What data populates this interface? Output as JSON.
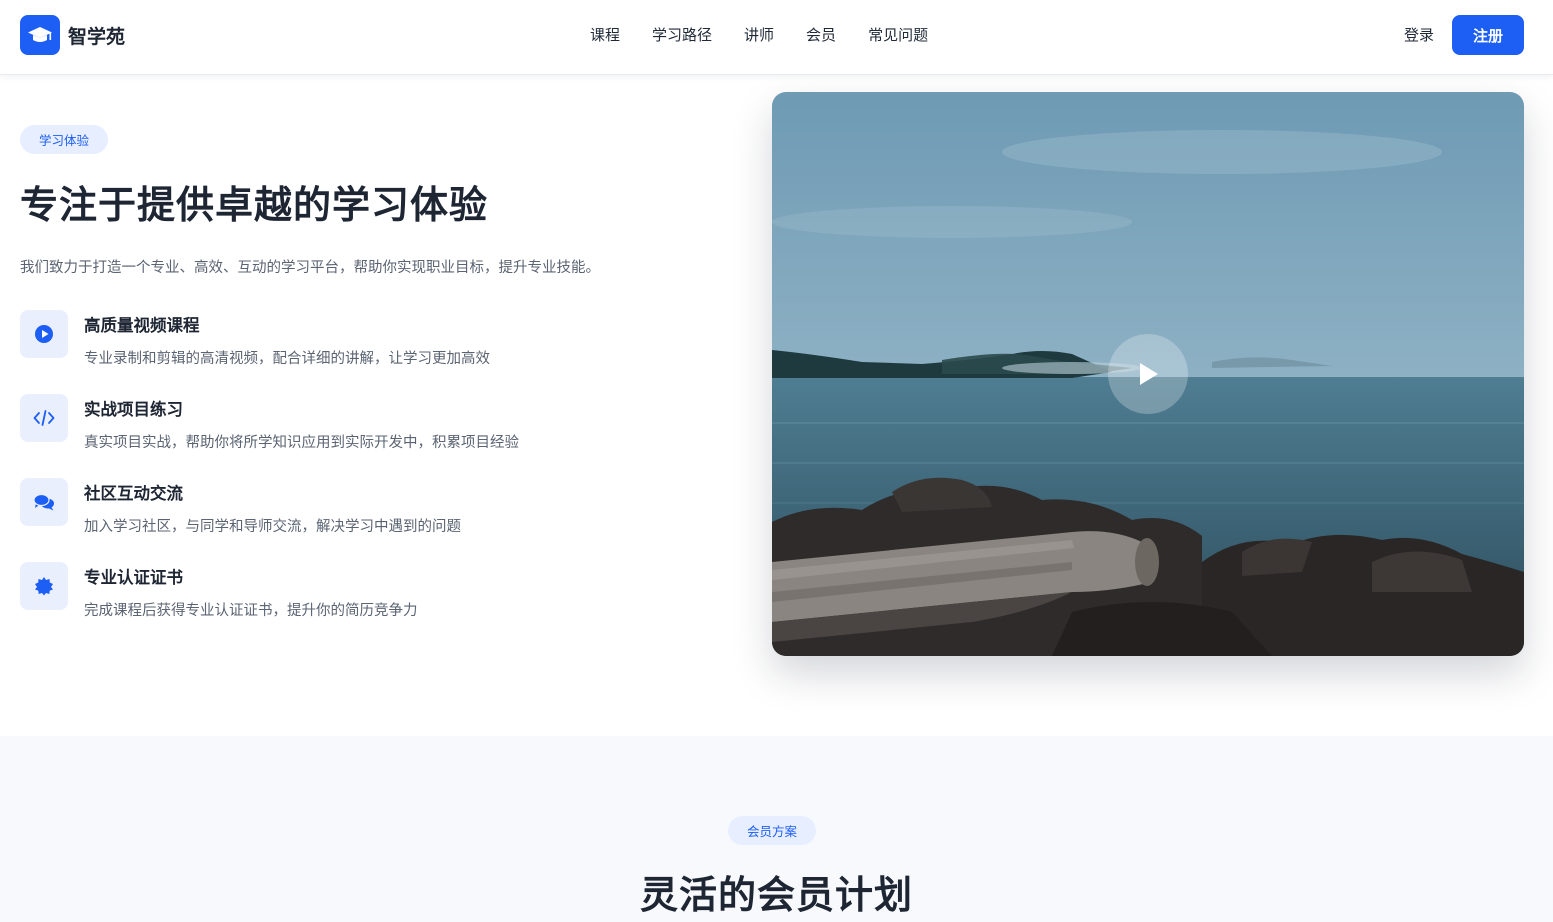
{
  "header": {
    "brand": "智学苑",
    "nav": [
      "课程",
      "学习路径",
      "讲师",
      "会员",
      "常见问题"
    ],
    "login": "登录",
    "register": "注册"
  },
  "hero": {
    "badge": "学习体验",
    "title": "专注于提供卓越的学习体验",
    "description": "我们致力于打造一个专业、高效、互动的学习平台，帮助你实现职业目标，提升专业技能。",
    "features": [
      {
        "icon": "play-circle-icon",
        "title": "高质量视频课程",
        "desc": "专业录制和剪辑的高清视频，配合详细的讲解，让学习更加高效"
      },
      {
        "icon": "code-icon",
        "title": "实战项目练习",
        "desc": "真实项目实战，帮助你将所学知识应用到实际开发中，积累项目经验"
      },
      {
        "icon": "chat-bubbles-icon",
        "title": "社区互动交流",
        "desc": "加入学习社区，与同学和导师交流，解决学习中遇到的问题"
      },
      {
        "icon": "certificate-badge-icon",
        "title": "专业认证证书",
        "desc": "完成课程后获得专业认证证书，提升你的简历竞争力"
      }
    ]
  },
  "membership": {
    "badge": "会员方案",
    "title": "灵活的会员计划"
  },
  "colors": {
    "accent": "#1d5ef5",
    "badge_bg": "#e6eeff",
    "text_dark": "#1e2533",
    "text_muted": "#5b6473",
    "section_bg": "#f7f9fc"
  }
}
